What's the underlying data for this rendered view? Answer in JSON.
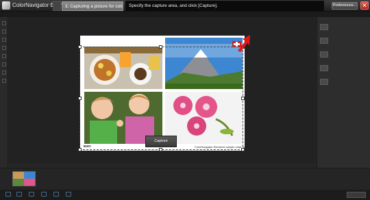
{
  "titlebar": {
    "app_title": "ColorNavigator Elements",
    "step_tab_label": "3. Capturing a picture for color matchin",
    "instruction": "Specify the capture area, and click [Capture].",
    "preferences_label": "Preferences...",
    "close_glyph": "✕"
  },
  "capture_area": {
    "capture_button_label": "Capture",
    "logo_text": "EIZO",
    "caption": "ColorNavigator Elements sample chart (sRGB)"
  },
  "colors": {
    "accent_red": "#e01818",
    "background": "#262626",
    "chart_bg": "#ffffff"
  },
  "icons": [
    "app-logo-icon",
    "home-icon",
    "close-icon",
    "red-arrow-icon"
  ]
}
